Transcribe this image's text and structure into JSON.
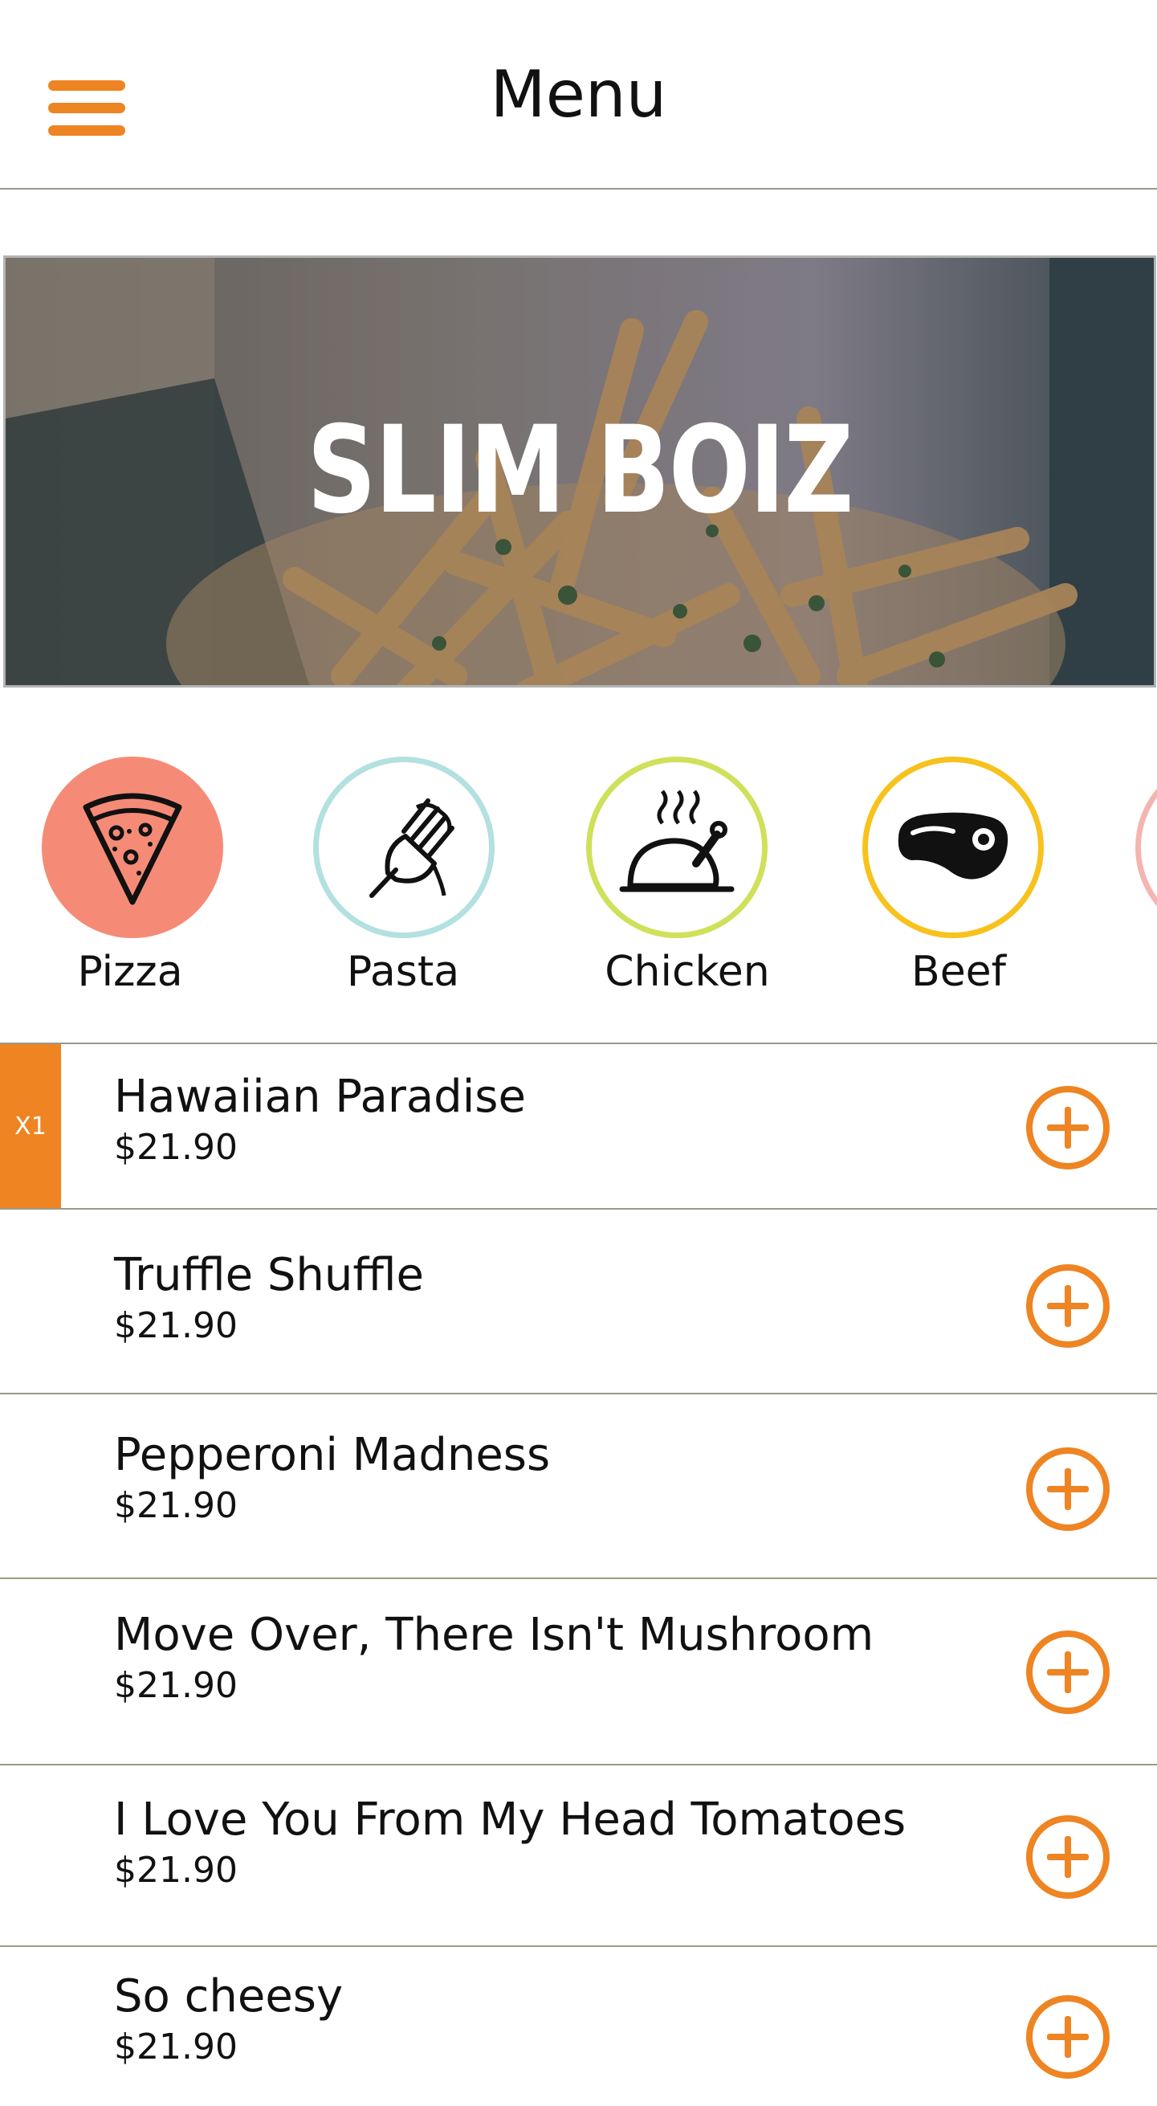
{
  "header": {
    "title": "Menu",
    "menu_icon": "hamburger-menu-icon",
    "accent_color": "#ee8422"
  },
  "hero": {
    "title": "SLIM BOIZ",
    "image": "fries-photo"
  },
  "categories": [
    {
      "label": "Pizza",
      "icon": "pizza-slice-icon",
      "color": "#f58b76",
      "selected": true
    },
    {
      "label": "Pasta",
      "icon": "fork-pasta-icon",
      "color": "#b3e0e0",
      "selected": false
    },
    {
      "label": "Chicken",
      "icon": "roast-chicken-icon",
      "color": "#cfe05a",
      "selected": false
    },
    {
      "label": "Beef",
      "icon": "steak-icon",
      "color": "#f7c21d",
      "selected": false
    }
  ],
  "items": [
    {
      "name": "Hawaiian Paradise",
      "price": "$21.90",
      "quantity": "X1"
    },
    {
      "name": "Truffle Shuffle",
      "price": "$21.90"
    },
    {
      "name": "Pepperoni Madness",
      "price": "$21.90"
    },
    {
      "name": "Move Over, There Isn't Mushroom",
      "price": "$21.90"
    },
    {
      "name": "I Love You From My Head Tomatoes",
      "price": "$21.90"
    },
    {
      "name": "So cheesy",
      "price": "$21.90"
    }
  ]
}
